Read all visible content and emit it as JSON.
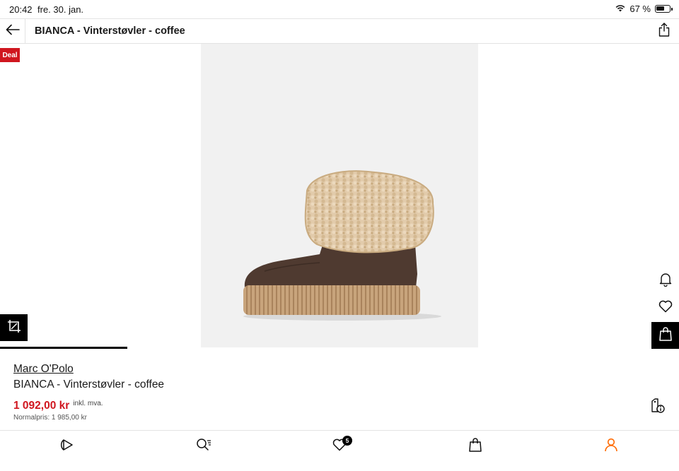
{
  "status_bar": {
    "time": "20:42",
    "date": "fre. 30. jan.",
    "battery_percent": "67 %",
    "battery_level": 0.67,
    "wifi_icon": "wifi-icon"
  },
  "header": {
    "title": "BIANCA - Vinterstøvler - coffee",
    "back_icon": "arrow-left-icon",
    "share_icon": "share-icon"
  },
  "gallery": {
    "deal_badge": "Deal",
    "image_alt": "brown suede winter boot with shearling cuff",
    "compare_icon": "crop-compare-icon",
    "scroll_progress": 0.1875
  },
  "side_actions": {
    "notify_icon": "bell-icon",
    "wishlist_icon": "heart-icon",
    "bag_icon": "shopping-bag-icon"
  },
  "product": {
    "brand": "Marc O'Polo",
    "name": "BIANCA - Vinterstøvler - coffee",
    "price": "1 092,00 kr",
    "vat_note": "inkl. mva.",
    "normal_price": "Normalpris: 1 985,00 kr",
    "size_info_icon": "tag-info-icon"
  },
  "bottom_nav": {
    "items": [
      {
        "icon": "home-play-icon"
      },
      {
        "icon": "search-list-icon"
      },
      {
        "icon": "heart-icon",
        "badge": "5"
      },
      {
        "icon": "shopping-bag-icon"
      },
      {
        "icon": "person-icon"
      }
    ]
  },
  "colors": {
    "accent_red": "#d0161f",
    "profile_active": "#ff6900",
    "text": "#1a1a1a",
    "image_bg": "#f1f1f1"
  }
}
